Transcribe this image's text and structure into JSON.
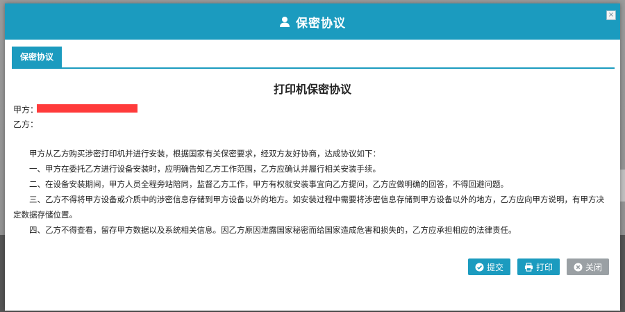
{
  "dialog": {
    "title": "保密协议",
    "close_glyph": "×",
    "tab_label": "保密协议"
  },
  "document": {
    "title": "打印机保密协议",
    "party_a_label": "甲方：",
    "party_b_label": "乙方：",
    "clauses": [
      "甲方从乙方购买涉密打印机并进行安装，根据国家有关保密要求，经双方友好协商，达成协议如下：",
      "一、甲方在委托乙方进行设备安装时，应明确告知乙方工作范围，乙方应确认并履行相关安装手续。",
      "二、在设备安装期间，甲方人员全程旁站陪同，监督乙方工作，甲方有权就安装事宜向乙方提问，乙方应做明确的回答，不得回避问题。",
      "三、乙方不得将甲方设备或介质中的涉密信息存储到甲方设备以外的地方。如安装过程中需要将涉密信息存储到甲方设备以外的地方，乙方应向甲方说明，有甲方决定数据存储位置。",
      "四、乙方不得查看，留存甲方数据以及系统相关信息。因乙方原因泄露国家秘密而给国家造成危害和损失的，乙方应承担相应的法律责任。"
    ]
  },
  "buttons": {
    "submit": "提交",
    "print": "打印",
    "close": "关闭"
  },
  "colors": {
    "accent": "#1b9bbf",
    "redacted": "#ff3b3b",
    "close_button": "#9aa0a4"
  },
  "icons": {
    "title": "user-icon",
    "submit": "check-circle-icon",
    "print": "printer-icon",
    "close": "x-circle-icon"
  }
}
